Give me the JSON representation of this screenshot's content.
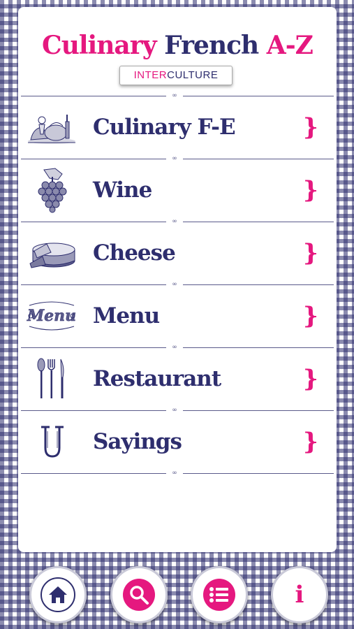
{
  "header": {
    "title_part1": "Culinary",
    "title_part2": "French",
    "title_part3": "A-Z",
    "brand_part1": "INTER",
    "brand_part2": "CULTURE"
  },
  "menu": {
    "items": [
      {
        "label": "Culinary F-E",
        "icon": "food-still-life-icon",
        "chevron": "}"
      },
      {
        "label": "Wine",
        "icon": "grapes-icon",
        "chevron": "}"
      },
      {
        "label": "Cheese",
        "icon": "cheese-wheel-icon",
        "chevron": "}"
      },
      {
        "label": "Menu",
        "icon": "menu-engraving-icon",
        "chevron": "}"
      },
      {
        "label": "Restaurant",
        "icon": "cutlery-icon",
        "chevron": "}"
      },
      {
        "label": "Sayings",
        "icon": "letter-u-icon",
        "chevron": "}"
      }
    ]
  },
  "toolbar": {
    "buttons": [
      {
        "name": "home",
        "icon": "home-icon"
      },
      {
        "name": "search",
        "icon": "search-icon"
      },
      {
        "name": "list",
        "icon": "list-icon"
      },
      {
        "name": "info",
        "icon": "info-icon",
        "glyph": "i"
      }
    ]
  },
  "colors": {
    "pink": "#e5187f",
    "navy": "#2e2e6e"
  }
}
